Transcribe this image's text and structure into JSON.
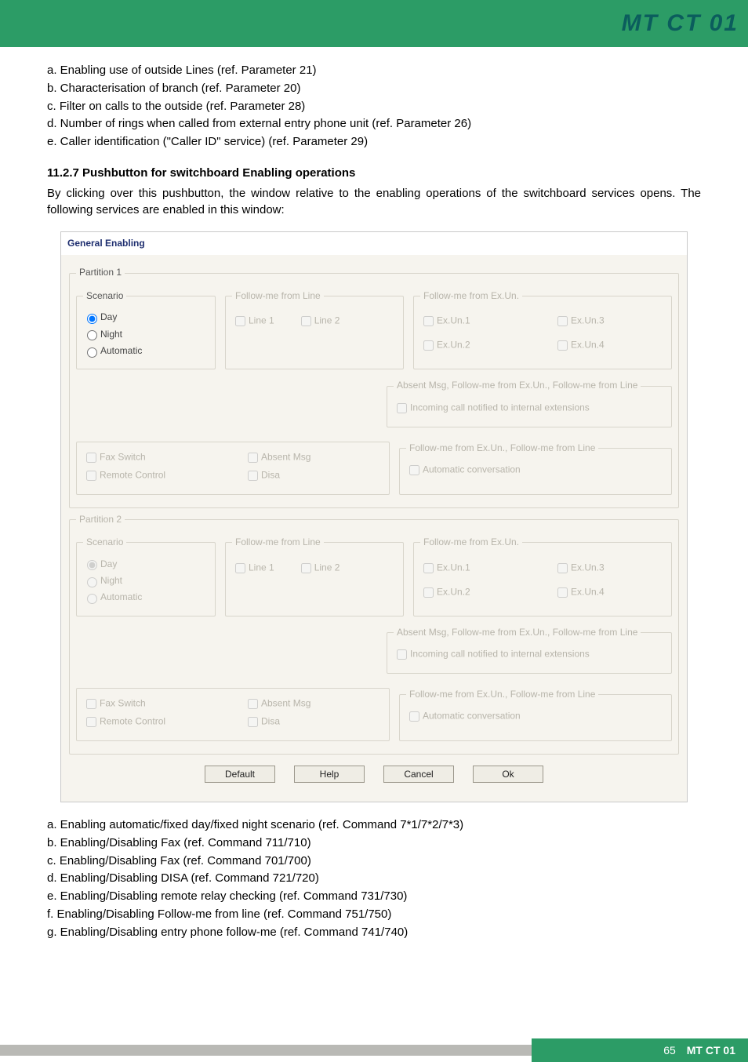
{
  "header": {
    "title": "MT CT 01"
  },
  "intro_list": [
    "a. Enabling use of outside Lines (ref. Parameter 21)",
    "b. Characterisation of branch (ref. Parameter 20)",
    "c. Filter on calls to the outside (ref. Parameter 28)",
    "d. Number of rings when called from external entry phone unit (ref. Parameter 26)",
    "e. Caller identification (\"Caller ID\" service) (ref. Parameter 29)"
  ],
  "subsection": {
    "heading": "11.2.7 Pushbutton for switchboard Enabling operations",
    "paragraph": "By clicking over this pushbutton, the window relative to the enabling operations of the switchboard services opens. The following services are enabled in this window:"
  },
  "dialog": {
    "title": "General Enabling",
    "buttons": {
      "default": "Default",
      "help": "Help",
      "cancel": "Cancel",
      "ok": "Ok"
    },
    "partitions": [
      {
        "legend": "Partition 1",
        "enabled": true,
        "scenario": {
          "legend": "Scenario",
          "opts": [
            "Day",
            "Night",
            "Automatic"
          ],
          "selected": 0
        },
        "follow_line": {
          "legend": "Follow-me from Line",
          "opts": [
            "Line 1",
            "Line 2"
          ]
        },
        "follow_ex": {
          "legend": "Follow-me from Ex.Un.",
          "opts": [
            "Ex.Un.1",
            "Ex.Un.3",
            "Ex.Un.2",
            "Ex.Un.4"
          ]
        },
        "absent": {
          "legend": "Absent Msg, Follow-me from Ex.Un., Follow-me from Line",
          "opt": "Incoming call notified to internal extensions"
        },
        "bottom_left": {
          "col1": [
            "Fax Switch",
            "Remote Control"
          ],
          "col2": [
            "Absent Msg",
            "Disa"
          ]
        },
        "follow_ex_line": {
          "legend": "Follow-me from Ex.Un., Follow-me from Line",
          "opt": "Automatic conversation"
        }
      },
      {
        "legend": "Partition 2",
        "enabled": false,
        "scenario": {
          "legend": "Scenario",
          "opts": [
            "Day",
            "Night",
            "Automatic"
          ],
          "selected": 0
        },
        "follow_line": {
          "legend": "Follow-me from Line",
          "opts": [
            "Line 1",
            "Line 2"
          ]
        },
        "follow_ex": {
          "legend": "Follow-me from Ex.Un.",
          "opts": [
            "Ex.Un.1",
            "Ex.Un.3",
            "Ex.Un.2",
            "Ex.Un.4"
          ]
        },
        "absent": {
          "legend": "Absent Msg, Follow-me from Ex.Un., Follow-me from Line",
          "opt": "Incoming call notified to internal extensions"
        },
        "bottom_left": {
          "col1": [
            "Fax Switch",
            "Remote Control"
          ],
          "col2": [
            "Absent Msg",
            "Disa"
          ]
        },
        "follow_ex_line": {
          "legend": "Follow-me from Ex.Un., Follow-me from Line",
          "opt": "Automatic conversation"
        }
      }
    ]
  },
  "after_list": [
    "a. Enabling automatic/fixed day/fixed night scenario (ref. Command 7*1/7*2/7*3)",
    "b. Enabling/Disabling Fax (ref. Command 711/710)",
    "c. Enabling/Disabling Fax (ref. Command 701/700)",
    "d. Enabling/Disabling DISA (ref. Command 721/720)",
    "e. Enabling/Disabling remote relay checking (ref. Command 731/730)",
    "f. Enabling/Disabling Follow-me from line (ref. Command 751/750)",
    "g. Enabling/Disabling entry phone follow-me (ref. Command 741/740)"
  ],
  "footer": {
    "page": "65",
    "code": "MT CT 01"
  }
}
